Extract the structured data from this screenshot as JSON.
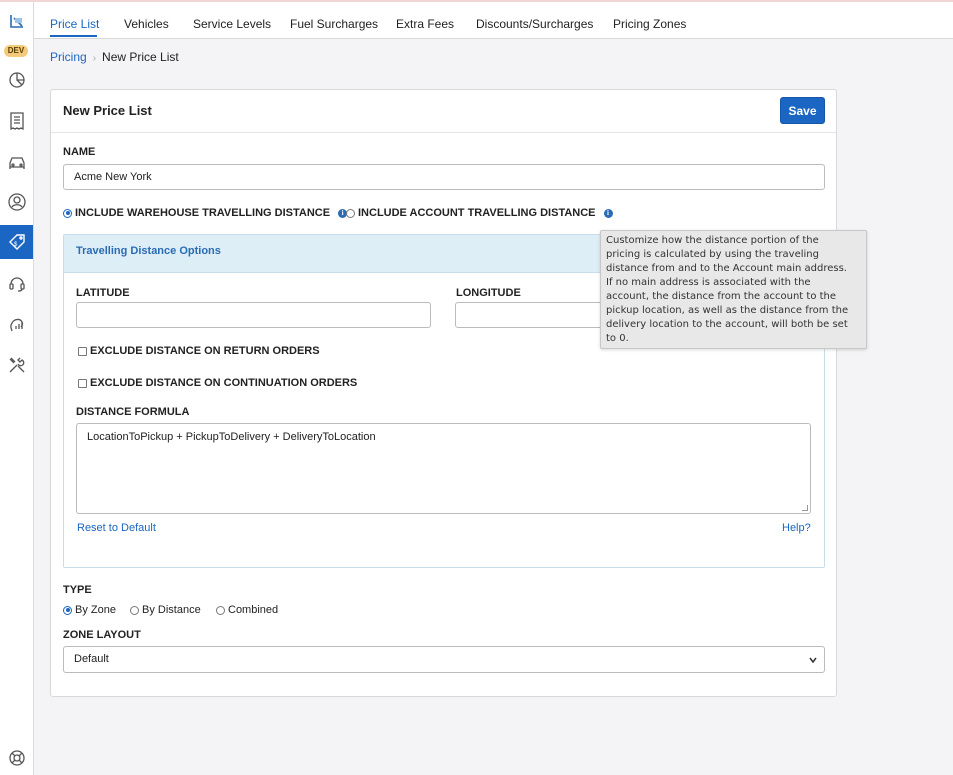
{
  "tabs": [
    {
      "label": "Price List",
      "active": true
    },
    {
      "label": "Vehicles",
      "active": false
    },
    {
      "label": "Service Levels",
      "active": false
    },
    {
      "label": "Fuel Surcharges",
      "active": false
    },
    {
      "label": "Extra Fees",
      "active": false
    },
    {
      "label": "Discounts/Surcharges",
      "active": false
    },
    {
      "label": "Pricing Zones",
      "active": false
    }
  ],
  "sidebar": {
    "badge": "DEV",
    "icons": [
      "logo-icon",
      "analytics-icon",
      "receipt-icon",
      "vehicle-icon",
      "user-icon",
      "pricing-tag-icon",
      "support-headset-icon",
      "reports-icon",
      "tools-icon",
      "help-lifebuoy-icon"
    ],
    "active_icon": "pricing-tag-icon"
  },
  "breadcrumb": {
    "parent": "Pricing",
    "current": "New Price List"
  },
  "card": {
    "title": "New Price List",
    "save_label": "Save",
    "name_label": "NAME",
    "name_value": "Acme New York",
    "distance_options": [
      {
        "label": "INCLUDE WAREHOUSE TRAVELLING DISTANCE",
        "checked": true
      },
      {
        "label": "INCLUDE ACCOUNT TRAVELLING DISTANCE",
        "checked": false
      }
    ],
    "travelling": {
      "title": "Travelling Distance Options",
      "latitude_label": "LATITUDE",
      "latitude_value": "",
      "longitude_label": "LONGITUDE",
      "longitude_value": "",
      "exclude_return_label": "EXCLUDE DISTANCE ON RETURN ORDERS",
      "exclude_continuation_label": "EXCLUDE DISTANCE ON CONTINUATION ORDERS",
      "formula_label": "DISTANCE FORMULA",
      "formula_value": "LocationToPickup + PickupToDelivery + DeliveryToLocation",
      "reset_label": "Reset to Default",
      "help_label": "Help?"
    },
    "type_label": "TYPE",
    "type_options": [
      {
        "label": "By Zone",
        "checked": true
      },
      {
        "label": "By Distance",
        "checked": false
      },
      {
        "label": "Combined",
        "checked": false
      }
    ],
    "zone_layout_label": "ZONE LAYOUT",
    "zone_layout_value": "Default"
  },
  "tooltip": {
    "lines": [
      "Customize how the distance portion of the",
      "pricing is calculated by using the traveling",
      "distance from and to the Account main address.",
      "If no main address is associated with the",
      "account, the distance from the account to the",
      "pickup location, as well as the distance from the",
      "delivery location to the account, will both be set",
      "to 0."
    ]
  },
  "colors": {
    "accent": "#1a66c2",
    "panel_header": "#deeef7",
    "badge": "#f3c97b"
  }
}
